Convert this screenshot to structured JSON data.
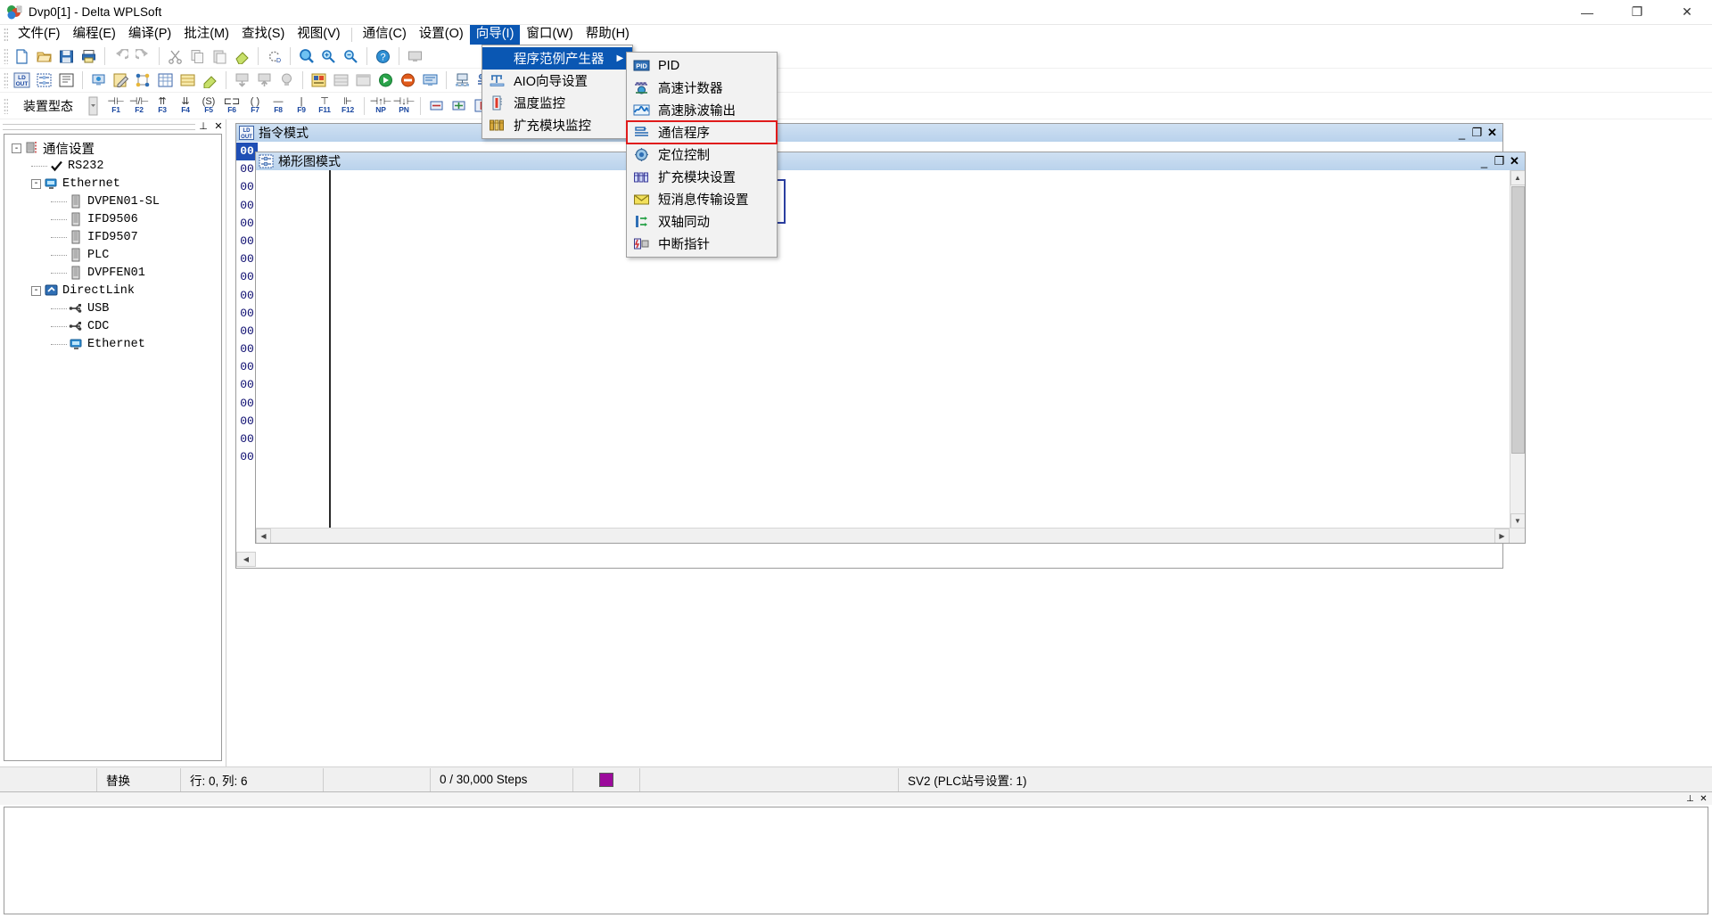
{
  "window": {
    "title": "Dvp0[1] - Delta WPLSoft",
    "icon": "delta-app-icon",
    "minimize_label": "—",
    "maximize_label": "❐",
    "close_label": "✕"
  },
  "menubar": {
    "items": [
      {
        "label": "文件(F)",
        "name": "menu-file",
        "active": false
      },
      {
        "label": "编程(E)",
        "name": "menu-edit-program",
        "active": false
      },
      {
        "label": "编译(P)",
        "name": "menu-compile",
        "active": false
      },
      {
        "label": "批注(M)",
        "name": "menu-comment",
        "active": false
      },
      {
        "label": "查找(S)",
        "name": "menu-search",
        "active": false
      },
      {
        "label": "视图(V)",
        "name": "menu-view",
        "active": false
      },
      {
        "label": "通信(C)",
        "name": "menu-communication",
        "active": false
      },
      {
        "label": "设置(O)",
        "name": "menu-options",
        "active": false
      },
      {
        "label": "向导(I)",
        "name": "menu-wizard",
        "active": true
      },
      {
        "label": "窗口(W)",
        "name": "menu-window",
        "active": false
      },
      {
        "label": "帮助(H)",
        "name": "menu-help",
        "active": false
      }
    ]
  },
  "wizard_menu": {
    "items": [
      {
        "label": "程序范例产生器",
        "name": "menu-item-program-sample-generator",
        "icon": "none",
        "highlighted": true,
        "submenu": true
      },
      {
        "label": "AIO向导设置",
        "name": "menu-item-aio-wizard-setup",
        "icon": "aio-icon",
        "highlighted": false,
        "submenu": false
      },
      {
        "label": "温度监控",
        "name": "menu-item-temperature-monitor",
        "icon": "thermometer-icon",
        "highlighted": false,
        "submenu": false
      },
      {
        "label": "扩充模块监控",
        "name": "menu-item-extension-module-monitor",
        "icon": "module-monitor-icon",
        "highlighted": false,
        "submenu": false
      }
    ]
  },
  "wizard_submenu": {
    "items": [
      {
        "label": "PID",
        "name": "submenu-item-pid",
        "icon": "pid-icon",
        "boxed": false
      },
      {
        "label": "高速计数器",
        "name": "submenu-item-high-speed-counter",
        "icon": "counter-icon",
        "boxed": false
      },
      {
        "label": "高速脉波输出",
        "name": "submenu-item-high-speed-pulse-output",
        "icon": "wave-icon",
        "boxed": false
      },
      {
        "label": "通信程序",
        "name": "submenu-item-communication-program",
        "icon": "comm-program-icon",
        "boxed": true
      },
      {
        "label": "定位控制",
        "name": "submenu-item-positioning-control",
        "icon": "positioning-icon",
        "boxed": false
      },
      {
        "label": "扩充模块设置",
        "name": "submenu-item-extension-module-setup",
        "icon": "module-icon",
        "boxed": false
      },
      {
        "label": "短消息传输设置",
        "name": "submenu-item-sms-transmission-setup",
        "icon": "envelope-icon",
        "boxed": false
      },
      {
        "label": "双轴同动",
        "name": "submenu-item-dual-axis-sync",
        "icon": "dual-axis-icon",
        "boxed": false
      },
      {
        "label": "中断指针",
        "name": "submenu-item-interrupt-pointer",
        "icon": "interrupt-icon",
        "boxed": false
      }
    ]
  },
  "toolbar_main": {
    "icons": [
      {
        "name": "new-file-icon"
      },
      {
        "name": "open-file-icon"
      },
      {
        "name": "save-icon"
      },
      {
        "name": "print-icon"
      },
      {
        "name": "undo-icon"
      },
      {
        "name": "redo-icon"
      },
      {
        "name": "cut-icon"
      },
      {
        "name": "copy-icon"
      },
      {
        "name": "paste-icon"
      },
      {
        "name": "eraser-icon"
      },
      {
        "name": "refresh-icon"
      },
      {
        "name": "zoom-icon"
      },
      {
        "name": "zoom-in-icon"
      },
      {
        "name": "zoom-out-icon"
      },
      {
        "name": "help-icon"
      },
      {
        "name": "monitor-icon"
      }
    ]
  },
  "toolbar_second": {
    "icons": [
      {
        "name": "ladder-instruction-icon",
        "label": "LD\nOUT"
      },
      {
        "name": "ladder-mode-icon"
      },
      {
        "name": "comment-mode-icon"
      },
      {
        "name": "plc-transfer-icon"
      },
      {
        "name": "edit-pencil-icon"
      },
      {
        "name": "hierarchy-icon"
      },
      {
        "name": "grid-icon"
      },
      {
        "name": "register-icon"
      },
      {
        "name": "highlight-icon"
      },
      {
        "name": "download-plc-icon"
      },
      {
        "name": "upload-plc-icon"
      },
      {
        "name": "bulb-icon"
      },
      {
        "name": "ladder-hmi-icon"
      },
      {
        "name": "table-icon"
      },
      {
        "name": "window-icon"
      },
      {
        "name": "run-plc-icon"
      },
      {
        "name": "stop-plc-icon"
      },
      {
        "name": "device-monitor-icon"
      },
      {
        "name": "plc-network-icon"
      },
      {
        "name": "comm-setup-icon"
      }
    ]
  },
  "toolbar_ladder": {
    "label": "装置型态",
    "keys": [
      {
        "glyph": "⊣⊢",
        "label": "F1",
        "name": "ladder-key-f1"
      },
      {
        "glyph": "⊣/⊢",
        "label": "F2",
        "name": "ladder-key-f2"
      },
      {
        "glyph": "⇈",
        "label": "F3",
        "name": "ladder-key-f3"
      },
      {
        "glyph": "⇊",
        "label": "F4",
        "name": "ladder-key-f4"
      },
      {
        "glyph": "(S)",
        "label": "F5",
        "name": "ladder-key-f5"
      },
      {
        "glyph": "⊏⊐",
        "label": "F6",
        "name": "ladder-key-f6"
      },
      {
        "glyph": "( )",
        "label": "F7",
        "name": "ladder-key-f7"
      },
      {
        "glyph": "—",
        "label": "F8",
        "name": "ladder-key-f8"
      },
      {
        "glyph": "|",
        "label": "F9",
        "name": "ladder-key-f9"
      },
      {
        "glyph": "⊤",
        "label": "F11",
        "name": "ladder-key-f11"
      },
      {
        "glyph": "⊩",
        "label": "F12",
        "name": "ladder-key-f12"
      },
      {
        "glyph": "⊣↑⊢",
        "label": "NP",
        "name": "ladder-key-np"
      },
      {
        "glyph": "⊣↓⊢",
        "label": "PN",
        "name": "ladder-key-pn"
      }
    ],
    "extra_icons": [
      {
        "name": "delete-row-icon"
      },
      {
        "name": "insert-row-icon"
      },
      {
        "name": "delete-col-icon"
      },
      {
        "name": "insert-col-icon"
      },
      {
        "name": "comment-row-icon"
      },
      {
        "name": "grid-toggle-icon"
      },
      {
        "name": "network-comment-icon"
      },
      {
        "name": "device-comment-icon"
      }
    ]
  },
  "tree_panel": {
    "caption": {
      "pin_label": "⊥",
      "close_label": "✕"
    },
    "nodes": [
      {
        "label": "通信设置",
        "name": "tree-node-comm-settings",
        "level": 0,
        "expander": "-",
        "icon": "comm-settings-icon",
        "zh": true
      },
      {
        "label": "RS232",
        "name": "tree-node-rs232",
        "level": 1,
        "expander": "",
        "icon": "check-icon",
        "zh": false
      },
      {
        "label": "Ethernet",
        "name": "tree-node-ethernet",
        "level": 1,
        "expander": "-",
        "icon": "ethernet-icon",
        "zh": false
      },
      {
        "label": "DVPEN01-SL",
        "name": "tree-node-dvpen01-sl",
        "level": 2,
        "expander": "",
        "icon": "module-card-icon",
        "zh": false
      },
      {
        "label": "IFD9506",
        "name": "tree-node-ifd9506",
        "level": 2,
        "expander": "",
        "icon": "module-card-icon",
        "zh": false
      },
      {
        "label": "IFD9507",
        "name": "tree-node-ifd9507",
        "level": 2,
        "expander": "",
        "icon": "module-card-icon",
        "zh": false
      },
      {
        "label": "PLC",
        "name": "tree-node-plc",
        "level": 2,
        "expander": "",
        "icon": "module-card-icon",
        "zh": false
      },
      {
        "label": "DVPFEN01",
        "name": "tree-node-dvpfen01",
        "level": 2,
        "expander": "",
        "icon": "module-card-icon",
        "zh": false
      },
      {
        "label": "DirectLink",
        "name": "tree-node-directlink",
        "level": 1,
        "expander": "-",
        "icon": "directlink-icon",
        "zh": false
      },
      {
        "label": "USB",
        "name": "tree-node-usb",
        "level": 2,
        "expander": "",
        "icon": "usb-icon",
        "zh": false
      },
      {
        "label": "CDC",
        "name": "tree-node-cdc",
        "level": 2,
        "expander": "",
        "icon": "usb-icon",
        "zh": false
      },
      {
        "label": "Ethernet",
        "name": "tree-node-directlink-ethernet",
        "level": 2,
        "expander": "",
        "icon": "ethernet-icon",
        "zh": false
      }
    ]
  },
  "instruction_window": {
    "title": "指令模式",
    "icon": "ld-out-icon",
    "minimize": "_",
    "maximize": "❐",
    "close": "✕",
    "line_numbers": [
      "00",
      "00",
      "00",
      "00",
      "00",
      "00",
      "00",
      "00",
      "00",
      "00",
      "00",
      "00",
      "00",
      "00",
      "00",
      "00",
      "00",
      "00"
    ]
  },
  "ladder_window": {
    "title": "梯形图模式",
    "icon": "ladder-icon",
    "minimize": "_",
    "maximize": "❐",
    "close": "✕",
    "vscroll_up": "▲",
    "vscroll_down": "▼",
    "hscroll_left": "◀",
    "hscroll_right": "▶"
  },
  "statusbar": {
    "mode": "替换",
    "position": "行: 0, 列: 6",
    "steps": "0 / 30,000 Steps",
    "indicator_color": "#9c0a9c",
    "plc_info": "SV2 (PLC站号设置: 1)"
  },
  "output_panel": {
    "pin_label": "⊥",
    "close_label": "✕"
  },
  "colors": {
    "menu_highlight": "#0a57b3",
    "red_box": "#e01b1b",
    "child_title": "#b9d2ec",
    "gutter_selected": "#1f4fb5"
  }
}
